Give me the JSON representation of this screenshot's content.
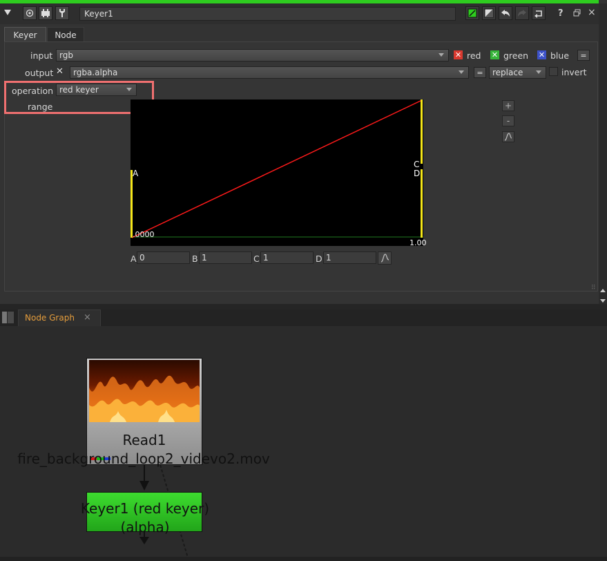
{
  "panel": {
    "node_name": "Keyer1",
    "tabs": [
      "Keyer",
      "Node"
    ],
    "input": {
      "label": "input",
      "value": "rgb",
      "channels": [
        {
          "name": "red",
          "color": "#d9392f"
        },
        {
          "name": "green",
          "color": "#37b43a"
        },
        {
          "name": "blue",
          "color": "#3d52c9"
        }
      ]
    },
    "output": {
      "label": "output",
      "value": "rgba.alpha",
      "mode": "replace",
      "invert_label": "invert"
    },
    "operation": {
      "label": "operation",
      "value": "red keyer"
    },
    "range_label": "range",
    "curve": {
      "marker_a": "A",
      "marker_cd_top": "C",
      "marker_cd_bottom": "D",
      "x_start_label": ".0000",
      "x_end_label": "1.00"
    },
    "fields": [
      {
        "label": "A",
        "value": "0"
      },
      {
        "label": "B",
        "value": "1"
      },
      {
        "label": "C",
        "value": "1"
      },
      {
        "label": "D",
        "value": "1"
      }
    ],
    "side_buttons": [
      "+",
      "-"
    ]
  },
  "node_graph": {
    "tab_label": "Node Graph",
    "read_node": {
      "title": "Read1",
      "file": "fire_background_loop2_videvo2.mov"
    },
    "keyer_node": {
      "line1": "Keyer1 (red keyer)",
      "line2": "(alpha)"
    }
  },
  "colors": {
    "accent_green": "#2ecc1f",
    "curve_red": "#ff1a1a",
    "handle_yellow": "#f5e619",
    "tab_orange": "#e59d3c",
    "highlight": "#f07070"
  }
}
